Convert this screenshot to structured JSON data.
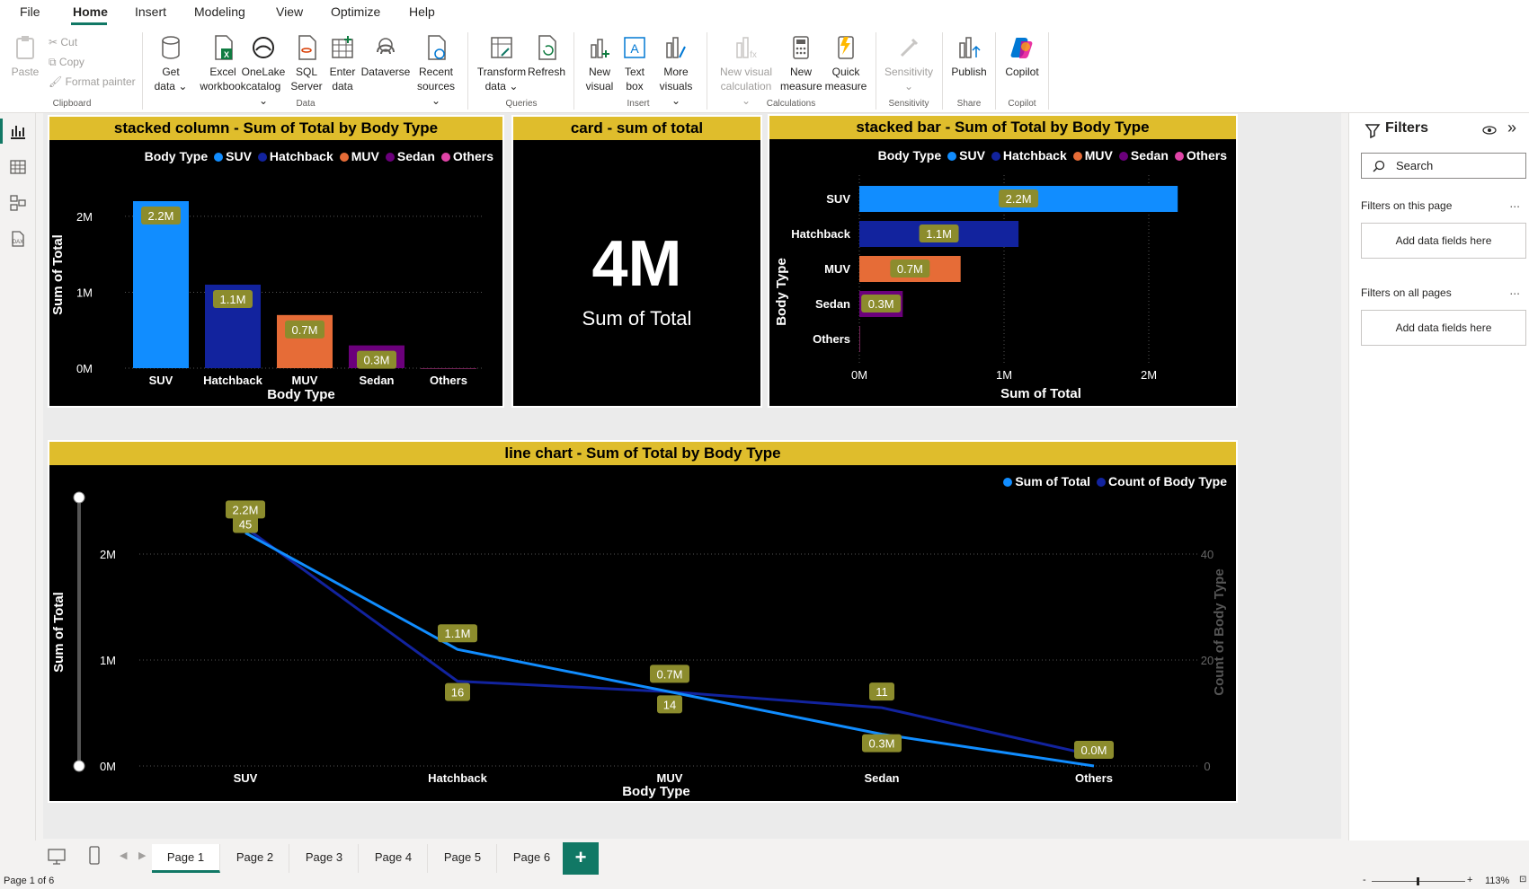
{
  "menu": {
    "tabs": [
      "File",
      "Home",
      "Insert",
      "Modeling",
      "View",
      "Optimize",
      "Help"
    ],
    "active": "Home"
  },
  "ribbon": {
    "clipboard": {
      "paste": "Paste",
      "cut": "Cut",
      "copy": "Copy",
      "format_painter": "Format painter",
      "label": "Clipboard"
    },
    "data": {
      "get_data": [
        "Get",
        "data ⌄"
      ],
      "excel": [
        "Excel",
        "workbook"
      ],
      "onelake": [
        "OneLake",
        "catalog ⌄"
      ],
      "sql": [
        "SQL",
        "Server"
      ],
      "enter": [
        "Enter",
        "data"
      ],
      "dataverse": "Dataverse",
      "recent": [
        "Recent",
        "sources ⌄"
      ],
      "label": "Data"
    },
    "queries": {
      "transform": [
        "Transform",
        "data ⌄"
      ],
      "refresh": "Refresh",
      "label": "Queries"
    },
    "insert": {
      "new_visual": [
        "New",
        "visual"
      ],
      "text_box": [
        "Text",
        "box"
      ],
      "more_visuals": [
        "More",
        "visuals ⌄"
      ],
      "label": "Insert"
    },
    "calculations": {
      "new_visual_calc": [
        "New visual",
        "calculation ⌄"
      ],
      "new_measure": [
        "New",
        "measure"
      ],
      "quick_measure": [
        "Quick",
        "measure"
      ],
      "label": "Calculations"
    },
    "sensitivity": {
      "button": "Sensitivity",
      "label": "Sensitivity"
    },
    "share": {
      "publish": "Publish",
      "label": "Share"
    },
    "copilot": {
      "button": "Copilot",
      "label": "Copilot"
    }
  },
  "colors": {
    "suv": "#118dff",
    "hatchback": "#12239e",
    "muv": "#e66c37",
    "sedan": "#6b007b",
    "others": "#e044a7",
    "title_bar": "#dfbd2c",
    "accent": "#117865",
    "data_label_bg": "#8c8c2d"
  },
  "legend": {
    "title": "Body Type",
    "items": [
      "SUV",
      "Hatchback",
      "MUV",
      "Sedan",
      "Others"
    ]
  },
  "visuals": {
    "column": {
      "title": "stacked column - Sum of Total by Body Type",
      "ylabel": "Sum of Total",
      "xlabel": "Body Type"
    },
    "card": {
      "title": "card - sum of total",
      "value": "4M",
      "label": "Sum of Total"
    },
    "bar": {
      "title": "stacked bar - Sum of Total by Body Type",
      "ylabel": "Body Type",
      "xlabel": "Sum of Total"
    },
    "line": {
      "title": "line chart - Sum of Total by Body Type",
      "legend": [
        "Sum of Total",
        "Count of Body Type"
      ],
      "ylabel": "Sum of Total",
      "y2label": "Count of Body Type",
      "xlabel": "Body Type"
    }
  },
  "chart_data": [
    {
      "type": "bar",
      "title": "stacked column - Sum of Total by Body Type",
      "categories": [
        "SUV",
        "Hatchback",
        "MUV",
        "Sedan",
        "Others"
      ],
      "values": [
        2.2,
        1.1,
        0.7,
        0.3,
        0.0
      ],
      "unit": "M",
      "data_labels": [
        "2.2M",
        "1.1M",
        "0.7M",
        "0.3M",
        ""
      ],
      "xlabel": "Body Type",
      "ylabel": "Sum of Total",
      "yticks": [
        "0M",
        "1M",
        "2M"
      ],
      "ylim": [
        0,
        2.2
      ],
      "legend_position": "top-right"
    },
    {
      "type": "bar",
      "orientation": "horizontal",
      "title": "stacked bar - Sum of Total by Body Type",
      "categories": [
        "SUV",
        "Hatchback",
        "MUV",
        "Sedan",
        "Others"
      ],
      "values": [
        2.2,
        1.1,
        0.7,
        0.3,
        0.0
      ],
      "unit": "M",
      "data_labels": [
        "2.2M",
        "1.1M",
        "0.7M",
        "0.3M",
        ""
      ],
      "xlabel": "Sum of Total",
      "ylabel": "Body Type",
      "xticks": [
        "0M",
        "1M",
        "2M"
      ],
      "xlim": [
        0,
        2.3
      ],
      "legend_position": "top-right"
    },
    {
      "type": "line",
      "title": "line chart - Sum of Total by Body Type",
      "categories": [
        "SUV",
        "Hatchback",
        "MUV",
        "Sedan",
        "Others"
      ],
      "series": [
        {
          "name": "Sum of Total",
          "values": [
            2.2,
            1.1,
            0.7,
            0.3,
            0.0
          ],
          "labels": [
            "2.2M",
            "1.1M",
            "0.7M",
            "0.3M",
            "0.0M"
          ],
          "axis": "left"
        },
        {
          "name": "Count of Body Type",
          "values": [
            45,
            16,
            14,
            11,
            2
          ],
          "labels": [
            "45",
            "16",
            "14",
            "11",
            ""
          ],
          "axis": "right"
        }
      ],
      "xlabel": "Body Type",
      "ylabel": "Sum of Total",
      "y2label": "Count of Body Type",
      "yticks": [
        "0M",
        "1M",
        "2M"
      ],
      "y2ticks": [
        "0",
        "20",
        "40"
      ],
      "ylim": [
        0,
        2.0
      ],
      "y2lim": [
        0,
        40
      ],
      "legend_position": "top-right"
    }
  ],
  "filters": {
    "title": "Filters",
    "search_placeholder": "Search",
    "on_page": "Filters on this page",
    "on_all": "Filters on all pages",
    "add_fields": "Add data fields here",
    "more": "..."
  },
  "pages": [
    "Page 1",
    "Page 2",
    "Page 3",
    "Page 4",
    "Page 5",
    "Page 6"
  ],
  "active_page": "Page 1",
  "add_page": "+",
  "status": {
    "page_info": "Page 1 of 6",
    "zoom": "113%",
    "zoom_minus": "-",
    "zoom_plus": "+"
  }
}
